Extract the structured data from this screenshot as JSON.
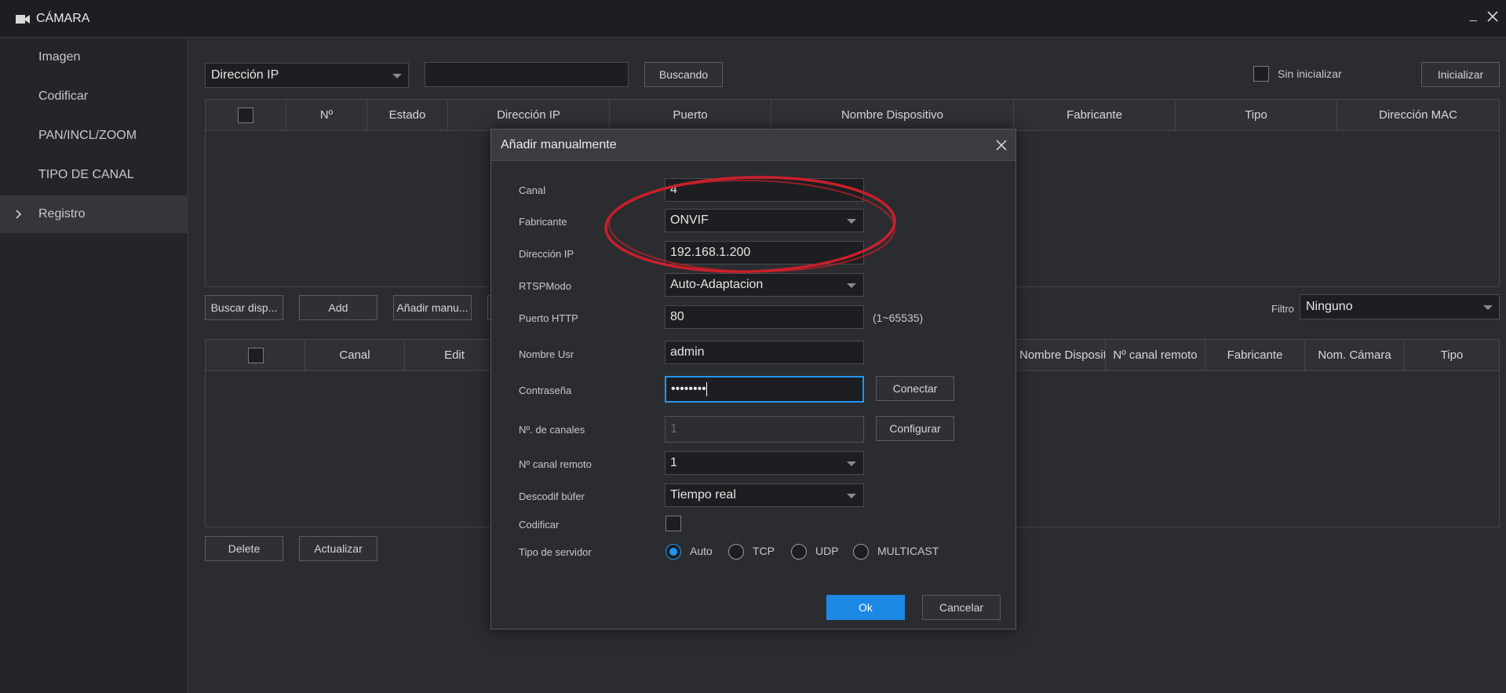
{
  "window": {
    "title": "CÁMARA",
    "minimize_glyph": "_",
    "accent_color": "#1e88e5"
  },
  "sidebar": {
    "items": [
      {
        "label": "Imagen"
      },
      {
        "label": "Codificar"
      },
      {
        "label": "PAN/INCL/ZOOM"
      },
      {
        "label": "TIPO DE CANAL"
      },
      {
        "label": "Registro"
      }
    ],
    "active_index": 4
  },
  "search_bar": {
    "type_select": "Dirección IP",
    "search_input": "",
    "search_button": "Buscando",
    "uninit_label": "Sin inicializar",
    "init_button": "Inicializar"
  },
  "found_table": {
    "columns": [
      "Nº",
      "Estado",
      "Dirección IP",
      "Puerto",
      "Nombre Dispositivo",
      "Fabricante",
      "Tipo",
      "Dirección MAC"
    ]
  },
  "actions_row": {
    "search_devices": "Buscar disp...",
    "add": "Add",
    "manual_add": "Añadir manu...",
    "filter_label": "Filtro",
    "filter_value": "Ninguno"
  },
  "added_table": {
    "columns": [
      "Canal",
      "Edit",
      "Nombre Dispositivo",
      "Nº canal remoto",
      "Fabricante",
      "Nom. Cámara",
      "Tipo"
    ]
  },
  "bottom_actions": {
    "delete": "Delete",
    "refresh": "Actualizar"
  },
  "dialog": {
    "title": "Añadir manualmente",
    "fields": {
      "canal": {
        "label": "Canal",
        "value": "4"
      },
      "fabricante": {
        "label": "Fabricante",
        "value": "ONVIF"
      },
      "ip": {
        "label": "Dirección IP",
        "value": "192.168.1.200"
      },
      "rtsp": {
        "label": "RTSPModo",
        "value": "Auto-Adaptacion"
      },
      "http_port": {
        "label": "Puerto HTTP",
        "value": "80",
        "hint": "(1~65535)"
      },
      "user": {
        "label": "Nombre Usr",
        "value": "admin"
      },
      "password": {
        "label": "Contraseña",
        "value": "••••••••",
        "connect_button": "Conectar"
      },
      "channels": {
        "label": "Nº. de canales",
        "value": "1",
        "configure_button": "Configurar"
      },
      "remote_channel": {
        "label": "Nº canal remoto",
        "value": "1"
      },
      "decode_buffer": {
        "label": "Descodif búfer",
        "value": "Tiempo real"
      },
      "encode": {
        "label": "Codificar"
      },
      "server_type": {
        "label": "Tipo de servidor",
        "options": [
          "Auto",
          "TCP",
          "UDP",
          "MULTICAST"
        ],
        "selected": "Auto"
      }
    },
    "ok": "Ok",
    "cancel": "Cancelar"
  },
  "annotation_color": "#c8202a"
}
